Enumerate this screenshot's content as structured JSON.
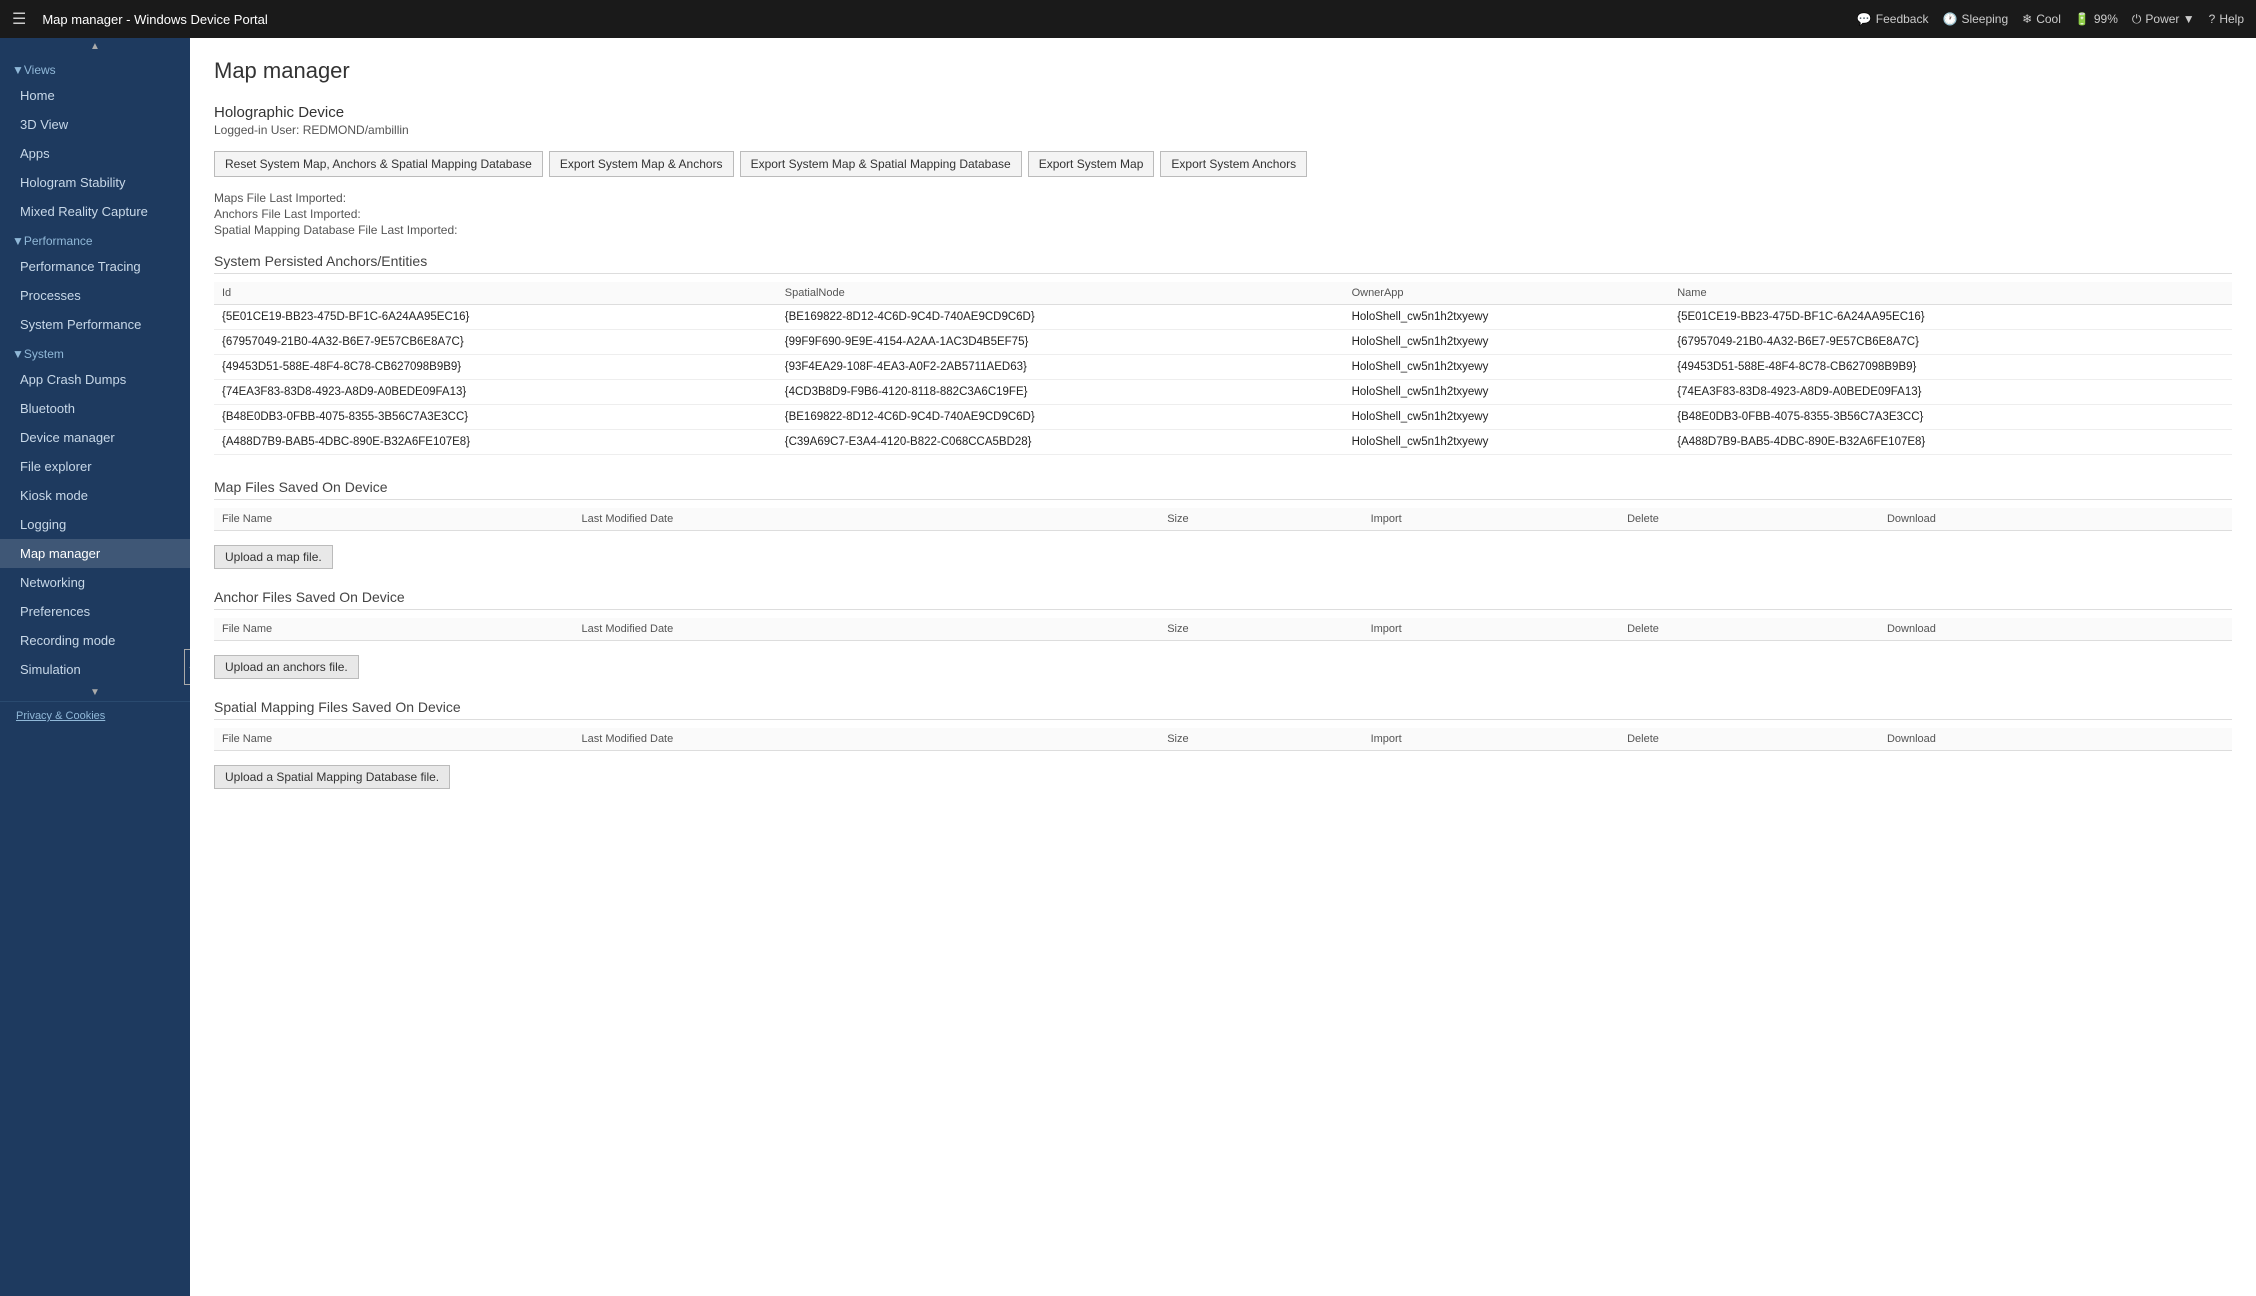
{
  "topbar": {
    "menu_icon": "☰",
    "title": "Map manager - Windows Device Portal",
    "actions": [
      {
        "id": "feedback",
        "icon": "💬",
        "label": "Feedback"
      },
      {
        "id": "sleeping",
        "icon": "🕐",
        "label": "Sleeping"
      },
      {
        "id": "cool",
        "icon": "❄",
        "label": "Cool"
      },
      {
        "id": "battery",
        "icon": "🔋",
        "label": "99%"
      },
      {
        "id": "power",
        "icon": "⏻",
        "label": "Power ▼"
      },
      {
        "id": "help",
        "icon": "?",
        "label": "Help"
      }
    ]
  },
  "sidebar": {
    "collapse_icon": "◀",
    "scroll_up": "▲",
    "scroll_down": "▼",
    "views_header": "▼Views",
    "views_items": [
      {
        "id": "home",
        "label": "Home"
      },
      {
        "id": "3d-view",
        "label": "3D View"
      },
      {
        "id": "apps",
        "label": "Apps"
      },
      {
        "id": "hologram-stability",
        "label": "Hologram Stability"
      },
      {
        "id": "mixed-reality-capture",
        "label": "Mixed Reality Capture"
      }
    ],
    "performance_header": "▼Performance",
    "performance_items": [
      {
        "id": "performance-tracing",
        "label": "Performance Tracing"
      },
      {
        "id": "processes",
        "label": "Processes"
      },
      {
        "id": "system-performance",
        "label": "System Performance"
      }
    ],
    "system_header": "▼System",
    "system_items": [
      {
        "id": "app-crash-dumps",
        "label": "App Crash Dumps"
      },
      {
        "id": "bluetooth",
        "label": "Bluetooth"
      },
      {
        "id": "device-manager",
        "label": "Device manager"
      },
      {
        "id": "file-explorer",
        "label": "File explorer"
      },
      {
        "id": "kiosk-mode",
        "label": "Kiosk mode"
      },
      {
        "id": "logging",
        "label": "Logging"
      },
      {
        "id": "map-manager",
        "label": "Map manager"
      },
      {
        "id": "networking",
        "label": "Networking"
      },
      {
        "id": "preferences",
        "label": "Preferences"
      },
      {
        "id": "recording-mode",
        "label": "Recording mode"
      },
      {
        "id": "simulation",
        "label": "Simulation"
      }
    ],
    "privacy_label": "Privacy & Cookies"
  },
  "content": {
    "page_title": "Map manager",
    "device_name": "Holographic Device",
    "logged_in": "Logged-in User: REDMOND/ambillin",
    "buttons": [
      {
        "id": "reset-system",
        "label": "Reset System Map, Anchors & Spatial Mapping Database"
      },
      {
        "id": "export-map-anchors",
        "label": "Export System Map & Anchors"
      },
      {
        "id": "export-spatial",
        "label": "Export System Map & Spatial Mapping Database"
      },
      {
        "id": "export-map",
        "label": "Export System Map"
      },
      {
        "id": "export-anchors",
        "label": "Export System Anchors"
      }
    ],
    "info_lines": [
      {
        "id": "maps-file",
        "label": "Maps File Last Imported:"
      },
      {
        "id": "anchors-file",
        "label": "Anchors File Last Imported:"
      },
      {
        "id": "spatial-file",
        "label": "Spatial Mapping Database File Last Imported:"
      }
    ],
    "anchors_section_title": "System Persisted Anchors/Entities",
    "anchors_columns": [
      "Id",
      "SpatialNode",
      "OwnerApp",
      "Name"
    ],
    "anchors_rows": [
      {
        "id": "{5E01CE19-BB23-475D-BF1C-6A24AA95EC16}",
        "spatial_node": "{BE169822-8D12-4C6D-9C4D-740AE9CD9C6D}",
        "owner_app": "HoloShell_cw5n1h2txyewy",
        "name": "{5E01CE19-BB23-475D-BF1C-6A24AA95EC16}"
      },
      {
        "id": "{67957049-21B0-4A32-B6E7-9E57CB6E8A7C}",
        "spatial_node": "{99F9F690-9E9E-4154-A2AA-1AC3D4B5EF75}",
        "owner_app": "HoloShell_cw5n1h2txyewy",
        "name": "{67957049-21B0-4A32-B6E7-9E57CB6E8A7C}"
      },
      {
        "id": "{49453D51-588E-48F4-8C78-CB627098B9B9}",
        "spatial_node": "{93F4EA29-108F-4EA3-A0F2-2AB5711AED63}",
        "owner_app": "HoloShell_cw5n1h2txyewy",
        "name": "{49453D51-588E-48F4-8C78-CB627098B9B9}"
      },
      {
        "id": "{74EA3F83-83D8-4923-A8D9-A0BEDE09FA13}",
        "spatial_node": "{4CD3B8D9-F9B6-4120-8118-882C3A6C19FE}",
        "owner_app": "HoloShell_cw5n1h2txyewy",
        "name": "{74EA3F83-83D8-4923-A8D9-A0BEDE09FA13}"
      },
      {
        "id": "{B48E0DB3-0FBB-4075-8355-3B56C7A3E3CC}",
        "spatial_node": "{BE169822-8D12-4C6D-9C4D-740AE9CD9C6D}",
        "owner_app": "HoloShell_cw5n1h2txyewy",
        "name": "{B48E0DB3-0FBB-4075-8355-3B56C7A3E3CC}"
      },
      {
        "id": "{A488D7B9-BAB5-4DBC-890E-B32A6FE107E8}",
        "spatial_node": "{C39A69C7-E3A4-4120-B822-C068CCA5BD28}",
        "owner_app": "HoloShell_cw5n1h2txyewy",
        "name": "{A488D7B9-BAB5-4DBC-890E-B32A6FE107E8}"
      }
    ],
    "map_files_section_title": "Map Files Saved On Device",
    "map_files_columns": [
      "File Name",
      "Last Modified Date",
      "Size",
      "Import",
      "Delete",
      "Download"
    ],
    "map_files_upload_btn": "Upload a map file.",
    "anchor_files_section_title": "Anchor Files Saved On Device",
    "anchor_files_columns": [
      "File Name",
      "Last Modified Date",
      "Size",
      "Import",
      "Delete",
      "Download"
    ],
    "anchor_files_upload_btn": "Upload an anchors file.",
    "spatial_files_section_title": "Spatial Mapping Files Saved On Device",
    "spatial_files_columns": [
      "File Name",
      "Last Modified Date",
      "Size",
      "Import",
      "Delete",
      "Download"
    ],
    "spatial_files_upload_btn": "Upload a Spatial Mapping Database file."
  }
}
